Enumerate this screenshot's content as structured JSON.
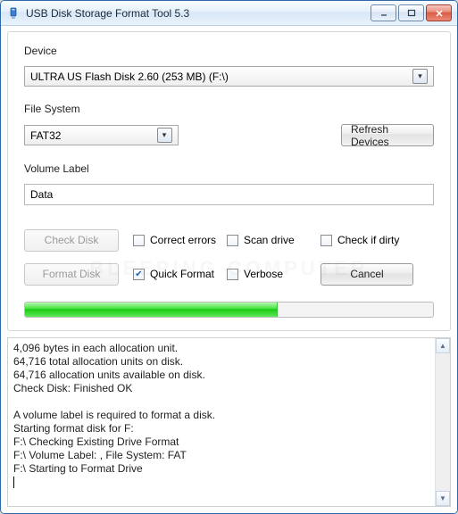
{
  "window": {
    "title": "USB Disk Storage Format Tool 5.3"
  },
  "labels": {
    "device": "Device",
    "filesystem": "File System",
    "volume": "Volume Label"
  },
  "device": {
    "selected": "ULTRA US  Flash Disk  2.60 (253 MB) (F:\\)"
  },
  "filesystem": {
    "selected": "FAT32"
  },
  "buttons": {
    "refresh": "Refresh Devices",
    "check": "Check Disk",
    "format": "Format Disk",
    "cancel": "Cancel"
  },
  "volume": {
    "value": "Data"
  },
  "check_opts": {
    "correct": "Correct errors",
    "scan": "Scan drive",
    "dirty": "Check if dirty"
  },
  "format_opts": {
    "quick": "Quick Format",
    "verbose": "Verbose"
  },
  "progress": {
    "percent": 62
  },
  "log": {
    "l1": "4,096 bytes in each allocation unit.",
    "l2": "64,716 total allocation units on disk.",
    "l3": "64,716 allocation units available on disk.",
    "l4": "Check Disk: Finished OK",
    "l5": "",
    "l6": "A volume label is required to format a disk.",
    "l7": "Starting format disk for F:",
    "l8": "F:\\ Checking Existing Drive Format",
    "l9": "F:\\ Volume Label: , File System: FAT",
    "l10": "F:\\ Starting to Format Drive"
  },
  "watermark": "BLEEPING COMPUTER"
}
